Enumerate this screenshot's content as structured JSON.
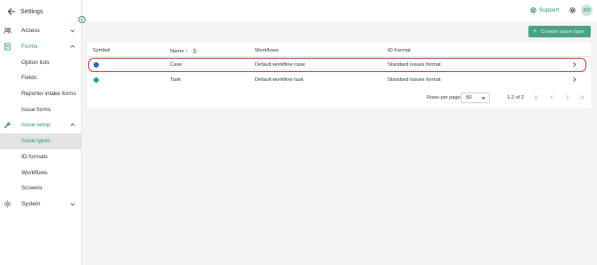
{
  "sidebar": {
    "title": "Settings",
    "items": [
      {
        "label": "Access"
      },
      {
        "label": "Forms"
      },
      {
        "label": "Issue setup"
      },
      {
        "label": "System"
      }
    ],
    "forms_sub": [
      "Option lists",
      "Fields",
      "Reporter intake forms",
      "Issue forms"
    ],
    "issue_setup_sub": [
      "Issue types",
      "ID formats",
      "Workflows",
      "Screens"
    ]
  },
  "topbar": {
    "support_label": "Support",
    "avatar_initials": "KD"
  },
  "create_button_label": "Create issue type",
  "table": {
    "headers": [
      "Symbol",
      "Name",
      "Workflows",
      "ID Format"
    ],
    "sort_indicator": "1",
    "rows": [
      {
        "symbol": "blue-circle",
        "name": "Case",
        "workflow": "Default workflow case",
        "id_format": "Standard issues format"
      },
      {
        "symbol": "green-diamond",
        "name": "Task",
        "workflow": "Default workflow task",
        "id_format": "Standard issues format"
      }
    ]
  },
  "pagination": {
    "rows_per_page_label": "Rows per page",
    "rows_per_page_value": "50",
    "range": "1-2 of 2"
  },
  "colors": {
    "brand_green": "#2f8f6e",
    "highlight_red": "#d63535",
    "case_symbol": "#2467c6",
    "task_symbol": "#26a383"
  }
}
